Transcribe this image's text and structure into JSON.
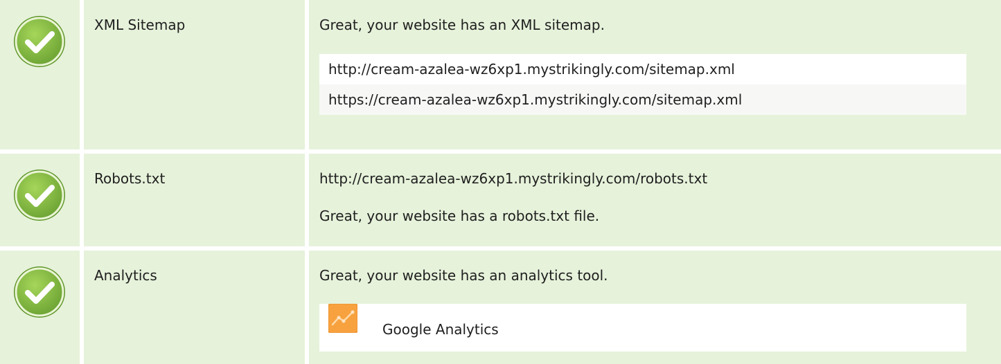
{
  "checks": [
    {
      "label": "XML Sitemap",
      "status": "passed",
      "message": "Great, your website has an XML sitemap.",
      "urls": [
        "http://cream-azalea-wz6xp1.mystrikingly.com/sitemap.xml",
        "https://cream-azalea-wz6xp1.mystrikingly.com/sitemap.xml"
      ]
    },
    {
      "label": "Robots.txt",
      "status": "passed",
      "url": "http://cream-azalea-wz6xp1.mystrikingly.com/robots.txt",
      "message": "Great, your website has a robots.txt file."
    },
    {
      "label": "Analytics",
      "status": "passed",
      "message": "Great, your website has an analytics tool.",
      "tool": {
        "name": "Google Analytics",
        "icon": "google-analytics-icon"
      }
    }
  ],
  "colors": {
    "row_background": "#e6f2da",
    "check_green": "#8dc63f",
    "check_green_dark": "#6ba233",
    "analytics_orange": "#f7a23f"
  }
}
